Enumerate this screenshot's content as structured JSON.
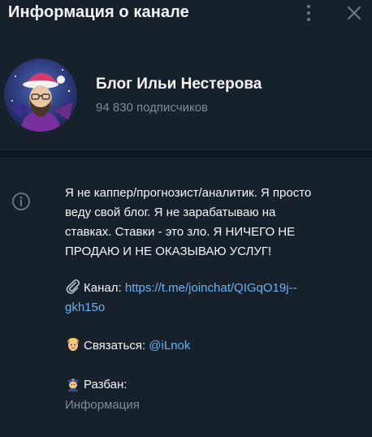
{
  "header": {
    "title": "Информация о канале",
    "menu_icon": "more-vertical-icon",
    "close_icon": "close-icon"
  },
  "channel": {
    "name": "Блог Ильи Нестерова",
    "subscribers": "94 830 подписчиков"
  },
  "info": {
    "description_lines": [
      "Я не каппер/прогнозист/аналитик. Я просто",
      "веду свой блог. Я не зарабатываю на",
      "ставках. Ставки - это зло. Я НИЧЕГО НЕ",
      "ПРОДАЮ И НЕ ОКАЗЫВАЮ УСЛУГ!"
    ],
    "channel_label": "Канал:",
    "channel_link_line1": "https://t.me/joinchat/QIGqO19j--",
    "channel_link_line2": "gkh15o",
    "contact_label": "Связаться:",
    "contact_link": "@iLnok",
    "ban_label": "Разбан:",
    "caption": "Информация"
  },
  "colors": {
    "background": "#17212b",
    "link": "#6ab3f3",
    "muted": "#7f8b96"
  }
}
